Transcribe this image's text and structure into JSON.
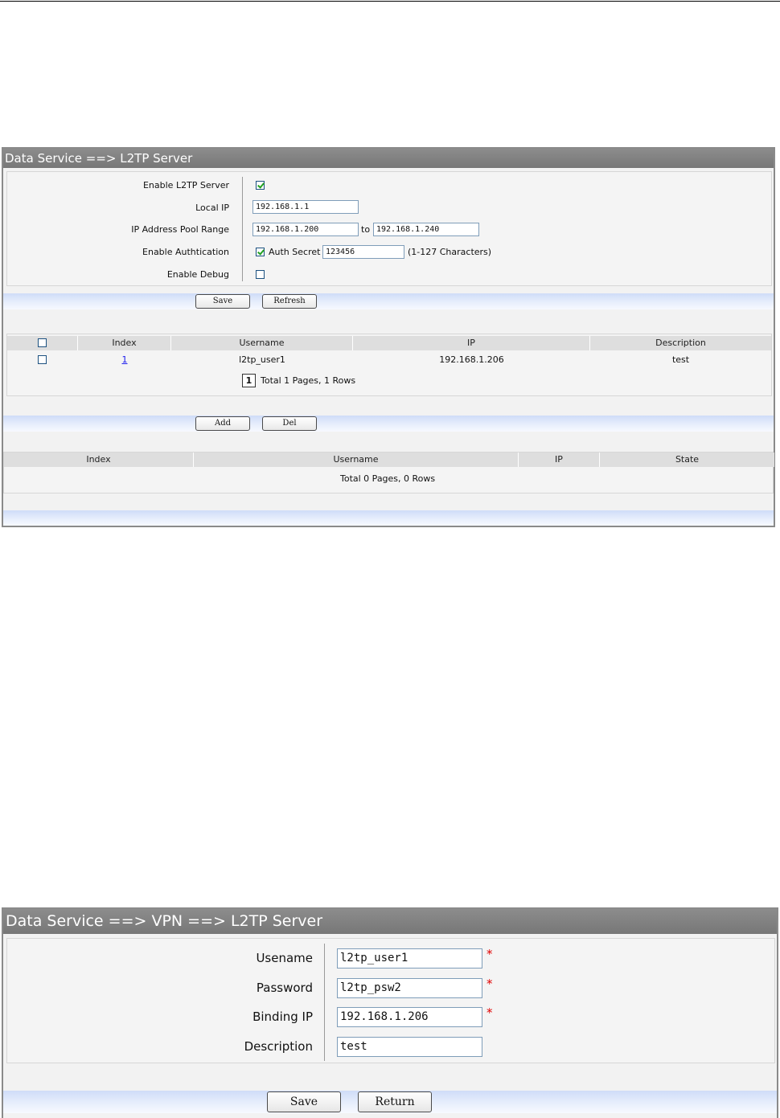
{
  "panel1": {
    "title": "Data Service ==> L2TP Server",
    "form": {
      "enable_label": "Enable L2TP Server",
      "enable_checked": true,
      "local_ip_label": "Local IP",
      "local_ip_value": "192.168.1.1",
      "pool_label": "IP Address Pool Range",
      "pool_start": "192.168.1.200",
      "pool_to": "to",
      "pool_end": "192.168.1.240",
      "auth_label": "Enable Authtication",
      "auth_checked": true,
      "auth_secret_label": "Auth Secret",
      "auth_secret_value": "123456",
      "auth_hint": "(1-127 Characters)",
      "debug_label": "Enable Debug",
      "debug_checked": false
    },
    "buttons": {
      "save": "Save",
      "refresh": "Refresh",
      "add": "Add",
      "del": "Del"
    },
    "users_table": {
      "headers": [
        "Index",
        "Username",
        "IP",
        "Description"
      ],
      "rows": [
        {
          "index": "1",
          "username": "l2tp_user1",
          "ip": "192.168.1.206",
          "description": "test"
        }
      ],
      "page_number": "1",
      "summary": "Total 1 Pages, 1 Rows"
    },
    "sessions_table": {
      "headers": [
        "Index",
        "Username",
        "IP",
        "State"
      ],
      "summary": "Total 0 Pages, 0 Rows"
    }
  },
  "panel2": {
    "title": "Data Service ==> VPN ==> L2TP Server",
    "fields": {
      "username_label": "Usename",
      "username_value": "l2tp_user1",
      "password_label": "Password",
      "password_value": "l2tp_psw2",
      "binding_ip_label": "Binding IP",
      "binding_ip_value": "192.168.1.206",
      "description_label": "Description",
      "description_value": "test",
      "required_mark": "*"
    },
    "buttons": {
      "save": "Save",
      "return": "Return"
    }
  }
}
